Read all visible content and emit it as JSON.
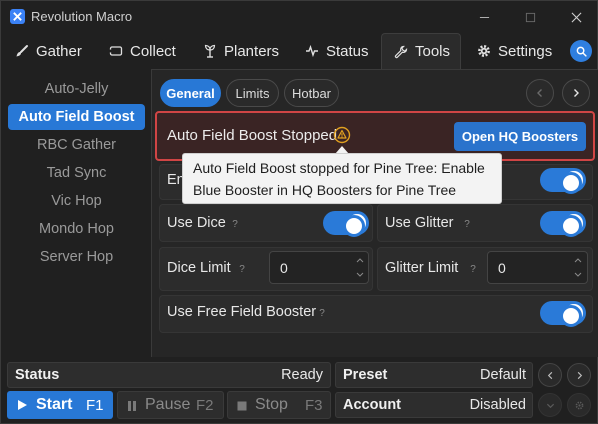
{
  "window": {
    "title": "Revolution Macro"
  },
  "tabs": [
    {
      "label": "Gather",
      "icon": "brush-icon"
    },
    {
      "label": "Collect",
      "icon": "ticket-icon"
    },
    {
      "label": "Planters",
      "icon": "sprout-icon"
    },
    {
      "label": "Status",
      "icon": "pulse-icon"
    },
    {
      "label": "Tools",
      "icon": "wrench-icon"
    },
    {
      "label": "Settings",
      "icon": "gear-icon"
    }
  ],
  "sidebar": {
    "items": [
      {
        "label": "Auto-Jelly"
      },
      {
        "label": "Auto Field Boost"
      },
      {
        "label": "RBC Gather"
      },
      {
        "label": "Tad Sync"
      },
      {
        "label": "Vic Hop"
      },
      {
        "label": "Mondo Hop"
      },
      {
        "label": "Server Hop"
      }
    ]
  },
  "subtabs": [
    {
      "label": "General"
    },
    {
      "label": "Limits"
    },
    {
      "label": "Hotbar"
    }
  ],
  "banner": {
    "text": "Auto Field Boost Stopped",
    "button": "Open HQ Boosters"
  },
  "tooltip": {
    "line1": "Auto Field Boost stopped for Pine Tree: Enable",
    "line2": "Blue Booster in HQ Boosters for Pine Tree"
  },
  "settings": {
    "enable_partial": "En",
    "use_dice": "Use Dice",
    "use_glitter": "Use Glitter",
    "dice_limit": "Dice Limit",
    "dice_limit_value": "0",
    "glitter_limit": "Glitter Limit",
    "glitter_limit_value": "0",
    "use_free_field_booster": "Use Free Field Booster",
    "help_glyph": "?"
  },
  "bottom": {
    "status_label": "Status",
    "status_value": "Ready",
    "preset_label": "Preset",
    "preset_value": "Default",
    "account_label": "Account",
    "account_value": "Disabled",
    "start_label": "Start",
    "start_key": "F1",
    "pause_label": "Pause",
    "pause_key": "F2",
    "stop_label": "Stop",
    "stop_key": "F3"
  },
  "colors": {
    "accent": "#2878d6",
    "error_border": "#d04545",
    "warning": "#e0a020"
  }
}
